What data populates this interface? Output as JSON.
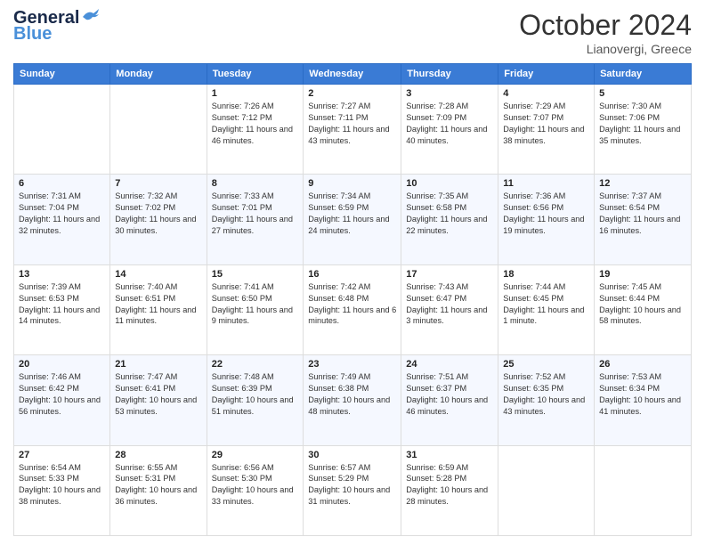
{
  "header": {
    "logo_line1": "General",
    "logo_line2": "Blue",
    "month": "October 2024",
    "location": "Lianovergi, Greece"
  },
  "days_of_week": [
    "Sunday",
    "Monday",
    "Tuesday",
    "Wednesday",
    "Thursday",
    "Friday",
    "Saturday"
  ],
  "weeks": [
    [
      {
        "day": "",
        "info": ""
      },
      {
        "day": "",
        "info": ""
      },
      {
        "day": "1",
        "info": "Sunrise: 7:26 AM\nSunset: 7:12 PM\nDaylight: 11 hours and 46 minutes."
      },
      {
        "day": "2",
        "info": "Sunrise: 7:27 AM\nSunset: 7:11 PM\nDaylight: 11 hours and 43 minutes."
      },
      {
        "day": "3",
        "info": "Sunrise: 7:28 AM\nSunset: 7:09 PM\nDaylight: 11 hours and 40 minutes."
      },
      {
        "day": "4",
        "info": "Sunrise: 7:29 AM\nSunset: 7:07 PM\nDaylight: 11 hours and 38 minutes."
      },
      {
        "day": "5",
        "info": "Sunrise: 7:30 AM\nSunset: 7:06 PM\nDaylight: 11 hours and 35 minutes."
      }
    ],
    [
      {
        "day": "6",
        "info": "Sunrise: 7:31 AM\nSunset: 7:04 PM\nDaylight: 11 hours and 32 minutes."
      },
      {
        "day": "7",
        "info": "Sunrise: 7:32 AM\nSunset: 7:02 PM\nDaylight: 11 hours and 30 minutes."
      },
      {
        "day": "8",
        "info": "Sunrise: 7:33 AM\nSunset: 7:01 PM\nDaylight: 11 hours and 27 minutes."
      },
      {
        "day": "9",
        "info": "Sunrise: 7:34 AM\nSunset: 6:59 PM\nDaylight: 11 hours and 24 minutes."
      },
      {
        "day": "10",
        "info": "Sunrise: 7:35 AM\nSunset: 6:58 PM\nDaylight: 11 hours and 22 minutes."
      },
      {
        "day": "11",
        "info": "Sunrise: 7:36 AM\nSunset: 6:56 PM\nDaylight: 11 hours and 19 minutes."
      },
      {
        "day": "12",
        "info": "Sunrise: 7:37 AM\nSunset: 6:54 PM\nDaylight: 11 hours and 16 minutes."
      }
    ],
    [
      {
        "day": "13",
        "info": "Sunrise: 7:39 AM\nSunset: 6:53 PM\nDaylight: 11 hours and 14 minutes."
      },
      {
        "day": "14",
        "info": "Sunrise: 7:40 AM\nSunset: 6:51 PM\nDaylight: 11 hours and 11 minutes."
      },
      {
        "day": "15",
        "info": "Sunrise: 7:41 AM\nSunset: 6:50 PM\nDaylight: 11 hours and 9 minutes."
      },
      {
        "day": "16",
        "info": "Sunrise: 7:42 AM\nSunset: 6:48 PM\nDaylight: 11 hours and 6 minutes."
      },
      {
        "day": "17",
        "info": "Sunrise: 7:43 AM\nSunset: 6:47 PM\nDaylight: 11 hours and 3 minutes."
      },
      {
        "day": "18",
        "info": "Sunrise: 7:44 AM\nSunset: 6:45 PM\nDaylight: 11 hours and 1 minute."
      },
      {
        "day": "19",
        "info": "Sunrise: 7:45 AM\nSunset: 6:44 PM\nDaylight: 10 hours and 58 minutes."
      }
    ],
    [
      {
        "day": "20",
        "info": "Sunrise: 7:46 AM\nSunset: 6:42 PM\nDaylight: 10 hours and 56 minutes."
      },
      {
        "day": "21",
        "info": "Sunrise: 7:47 AM\nSunset: 6:41 PM\nDaylight: 10 hours and 53 minutes."
      },
      {
        "day": "22",
        "info": "Sunrise: 7:48 AM\nSunset: 6:39 PM\nDaylight: 10 hours and 51 minutes."
      },
      {
        "day": "23",
        "info": "Sunrise: 7:49 AM\nSunset: 6:38 PM\nDaylight: 10 hours and 48 minutes."
      },
      {
        "day": "24",
        "info": "Sunrise: 7:51 AM\nSunset: 6:37 PM\nDaylight: 10 hours and 46 minutes."
      },
      {
        "day": "25",
        "info": "Sunrise: 7:52 AM\nSunset: 6:35 PM\nDaylight: 10 hours and 43 minutes."
      },
      {
        "day": "26",
        "info": "Sunrise: 7:53 AM\nSunset: 6:34 PM\nDaylight: 10 hours and 41 minutes."
      }
    ],
    [
      {
        "day": "27",
        "info": "Sunrise: 6:54 AM\nSunset: 5:33 PM\nDaylight: 10 hours and 38 minutes."
      },
      {
        "day": "28",
        "info": "Sunrise: 6:55 AM\nSunset: 5:31 PM\nDaylight: 10 hours and 36 minutes."
      },
      {
        "day": "29",
        "info": "Sunrise: 6:56 AM\nSunset: 5:30 PM\nDaylight: 10 hours and 33 minutes."
      },
      {
        "day": "30",
        "info": "Sunrise: 6:57 AM\nSunset: 5:29 PM\nDaylight: 10 hours and 31 minutes."
      },
      {
        "day": "31",
        "info": "Sunrise: 6:59 AM\nSunset: 5:28 PM\nDaylight: 10 hours and 28 minutes."
      },
      {
        "day": "",
        "info": ""
      },
      {
        "day": "",
        "info": ""
      }
    ]
  ]
}
